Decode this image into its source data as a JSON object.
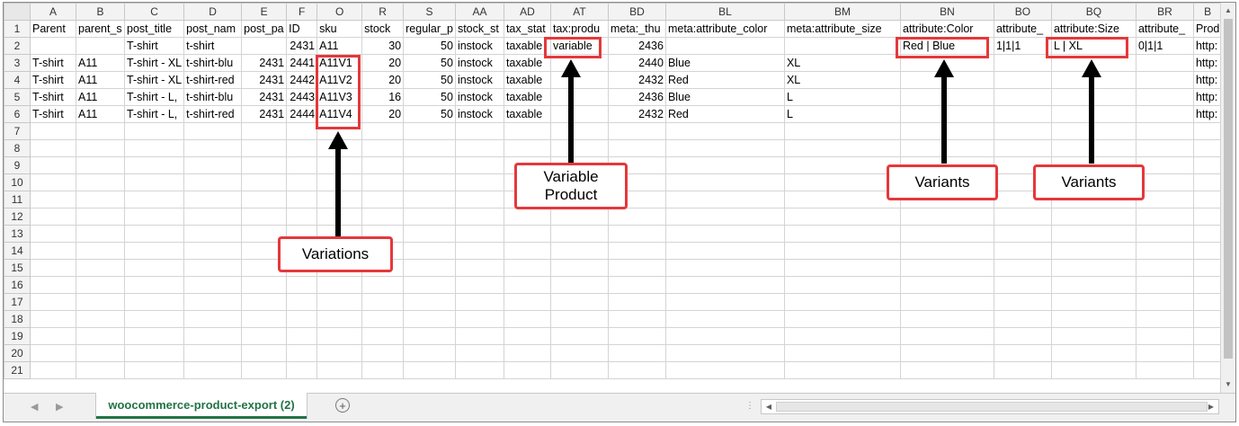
{
  "columns": [
    "A",
    "B",
    "C",
    "D",
    "E",
    "F",
    "O",
    "R",
    "S",
    "AA",
    "AD",
    "AT",
    "BD",
    "BL",
    "BM",
    "BN",
    "BO",
    "BQ",
    "BR",
    "B"
  ],
  "row_numbers": [
    "1",
    "2",
    "3",
    "4",
    "5",
    "6",
    "7",
    "8",
    "9",
    "10",
    "11",
    "12",
    "13",
    "14",
    "15",
    "16",
    "17",
    "18",
    "19",
    "20",
    "21"
  ],
  "rows": [
    [
      "Parent",
      "parent_s",
      "post_title",
      "post_nam",
      "post_pa",
      "ID",
      "sku",
      "stock",
      "regular_p",
      "stock_st",
      "tax_stat",
      "tax:produ",
      "meta:_thu",
      "meta:attribute_color",
      "meta:attribute_size",
      "attribute:Color",
      "attribute_",
      "attribute:Size",
      "attribute_",
      "Prod"
    ],
    [
      "",
      "",
      "T-shirt",
      "t-shirt",
      "",
      "2431",
      "A11",
      "30",
      "50",
      "instock",
      "taxable",
      "variable",
      "2436",
      "",
      "",
      "Red | Blue",
      "1|1|1",
      "L | XL",
      "0|1|1",
      "http:"
    ],
    [
      "T-shirt",
      "A11",
      "T-shirt - XL",
      "t-shirt-blu",
      "2431",
      "2441",
      "A11V1",
      "20",
      "50",
      "instock",
      "taxable",
      "",
      "2440",
      "Blue",
      "XL",
      "",
      "",
      "",
      "",
      "http:"
    ],
    [
      "T-shirt",
      "A11",
      "T-shirt - XL",
      "t-shirt-red",
      "2431",
      "2442",
      "A11V2",
      "20",
      "50",
      "instock",
      "taxable",
      "",
      "2432",
      "Red",
      "XL",
      "",
      "",
      "",
      "",
      "http:"
    ],
    [
      "T-shirt",
      "A11",
      "T-shirt - L,",
      "t-shirt-blu",
      "2431",
      "2443",
      "A11V3",
      "16",
      "50",
      "instock",
      "taxable",
      "",
      "2436",
      "Blue",
      "L",
      "",
      "",
      "",
      "",
      "http:"
    ],
    [
      "T-shirt",
      "A11",
      "T-shirt - L,",
      "t-shirt-red",
      "2431",
      "2444",
      "A11V4",
      "20",
      "50",
      "instock",
      "taxable",
      "",
      "2432",
      "Red",
      "L",
      "",
      "",
      "",
      "",
      "http:"
    ]
  ],
  "numeric_columns": [
    4,
    5,
    7,
    8,
    12
  ],
  "selected_row": "20",
  "sheet_tab": "woocommerce-product-export (2)",
  "callouts": {
    "variations": "Variations",
    "variable_product_line1": "Variable",
    "variable_product_line2": "Product",
    "variants_color": "Variants",
    "variants_size": "Variants"
  },
  "icons": {
    "add_sheet": "plus-circle-icon",
    "nav_prev": "triangle-left-icon",
    "nav_next": "triangle-right-icon"
  },
  "colors": {
    "highlight": "#e5383b",
    "sheet_tab_accent": "#217346"
  }
}
